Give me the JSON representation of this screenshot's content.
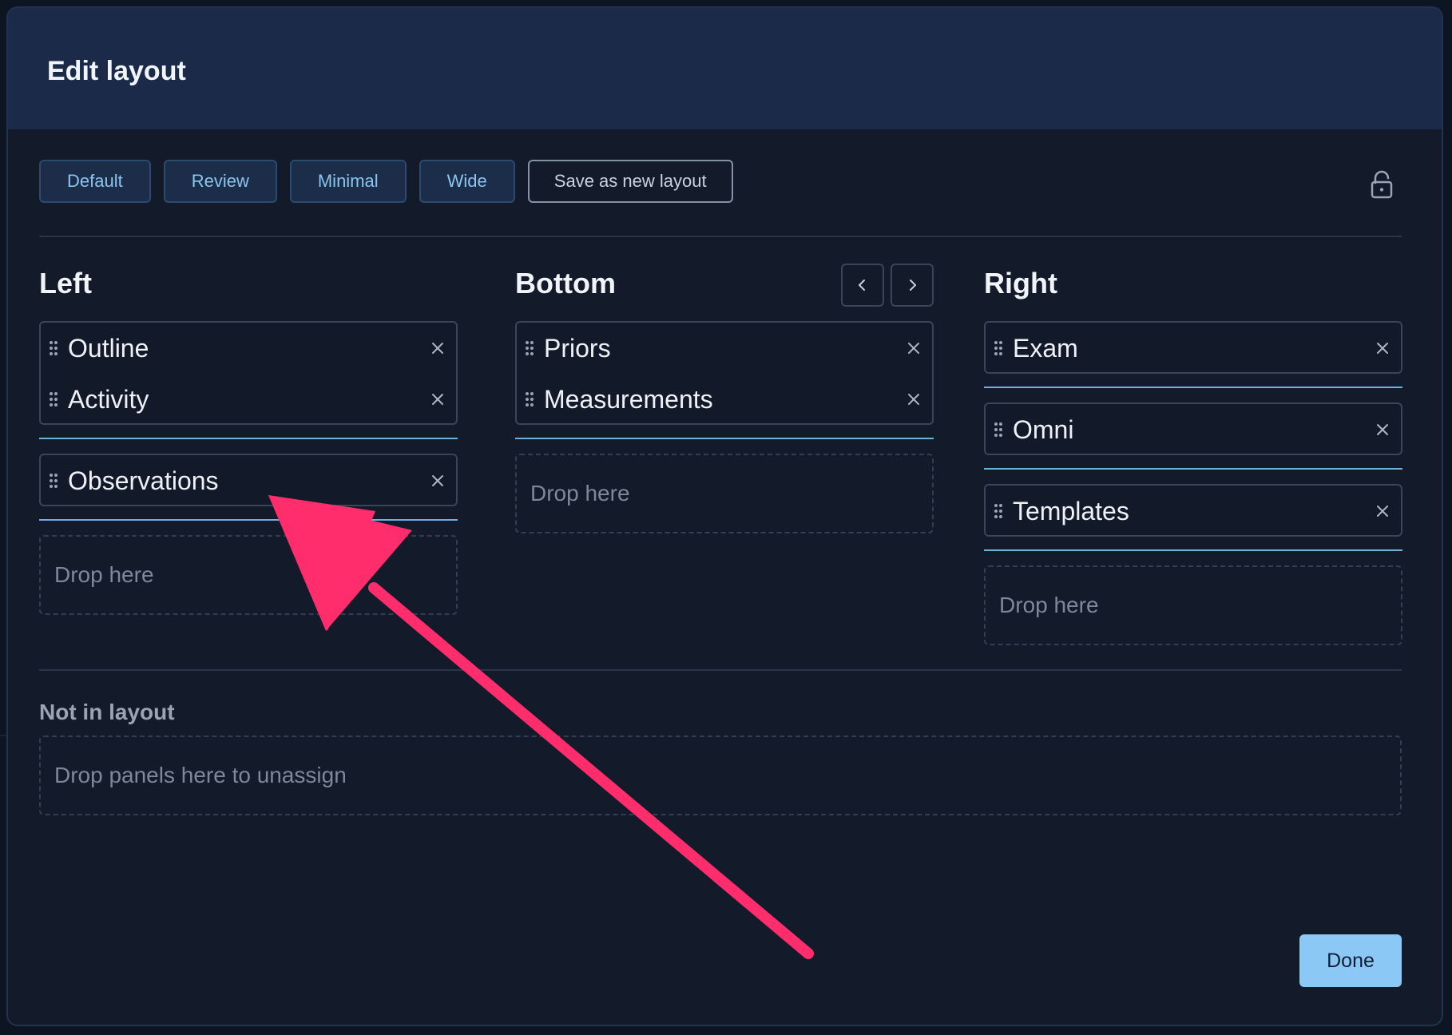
{
  "modal": {
    "title": "Edit layout",
    "presets": [
      "Default",
      "Review",
      "Minimal",
      "Wide"
    ],
    "save_label": "Save as new layout"
  },
  "columns": {
    "left": {
      "title": "Left",
      "groups": [
        [
          "Outline",
          "Activity"
        ],
        [
          "Observations"
        ]
      ],
      "drop": "Drop here"
    },
    "bottom": {
      "title": "Bottom",
      "groups": [
        [
          "Priors",
          "Measurements"
        ]
      ],
      "drop": "Drop here"
    },
    "right": {
      "title": "Right",
      "groups": [
        [
          "Exam"
        ],
        [
          "Omni"
        ],
        [
          "Templates"
        ]
      ],
      "drop": "Drop here"
    }
  },
  "unassigned": {
    "title": "Not in layout",
    "placeholder": "Drop panels here to unassign"
  },
  "done_label": "Done",
  "colors": {
    "accent": "#8cc8f5",
    "arrow": "#ff2d6b",
    "separator": "#6fb1de"
  }
}
